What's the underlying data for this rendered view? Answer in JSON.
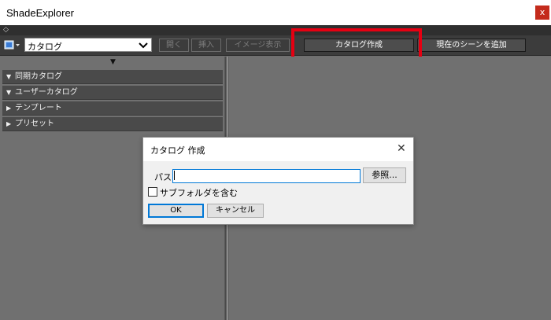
{
  "window": {
    "title": "ShadeExplorer",
    "close_glyph": "x",
    "strip_icon": "◇"
  },
  "toolbar": {
    "catalog_select": {
      "value": "カタログ",
      "icon": "catalog-icon"
    },
    "buttons": [
      {
        "label": "開く",
        "enabled": false
      },
      {
        "label": "挿入",
        "enabled": false
      },
      {
        "label": "イメージ表示",
        "enabled": false
      },
      {
        "label": "カタログ作成",
        "enabled": true
      },
      {
        "label": "現在のシーンを追加",
        "enabled": true
      }
    ],
    "highlight_color": "#e60012"
  },
  "left_panel": {
    "collapse_glyph": "▼",
    "items": [
      {
        "expander": "▼",
        "label": "同期カタログ"
      },
      {
        "expander": "▼",
        "label": "ユーザーカタログ"
      },
      {
        "expander": "▶",
        "label": "テンプレート"
      },
      {
        "expander": "▶",
        "label": "プリセット"
      }
    ]
  },
  "dialog": {
    "title": "カタログ 作成",
    "close_glyph": "✕",
    "path_label": "パス",
    "path_value": "",
    "browse_label": "参照...",
    "include_subfolders_label": "サブフォルダを含む",
    "include_subfolders_checked": false,
    "ok_label": "OK",
    "cancel_label": "キャンセル"
  }
}
